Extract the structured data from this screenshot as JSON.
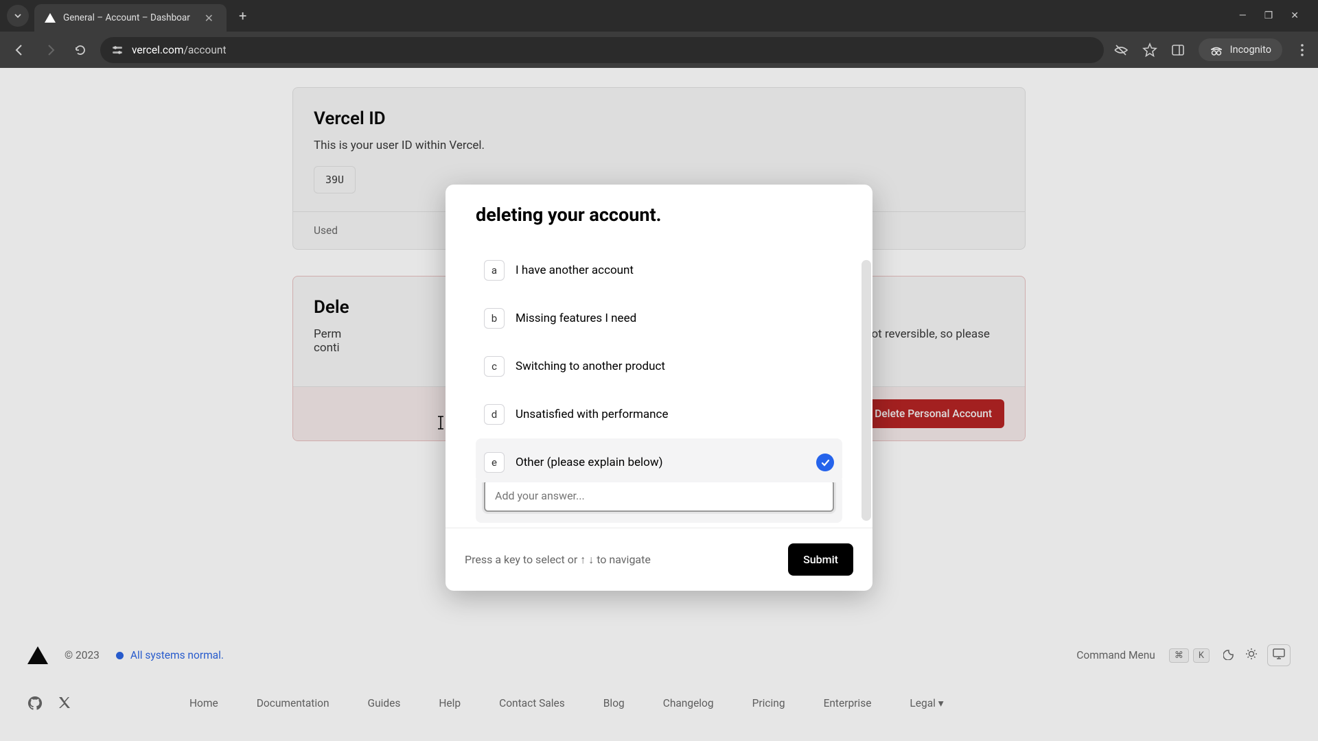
{
  "browser": {
    "tab_title": "General – Account – Dashboar",
    "url_prefix": "vercel.com",
    "url_path": "/account",
    "incognito_label": "Incognito"
  },
  "vercel_id_card": {
    "title": "Vercel ID",
    "desc": "This is your user ID within Vercel.",
    "value": "39U",
    "footer": "Used"
  },
  "delete_card": {
    "title_prefix": "Dele",
    "desc_line1a": "Perm",
    "desc_line1b": "atform. This action is not reversible, so please",
    "desc_line2": "conti",
    "button": "Delete Personal Account"
  },
  "modal": {
    "title": "deleting your account.",
    "options": [
      {
        "key": "a",
        "label": "I have another account",
        "selected": false
      },
      {
        "key": "b",
        "label": "Missing features I need",
        "selected": false
      },
      {
        "key": "c",
        "label": "Switching to another product",
        "selected": false
      },
      {
        "key": "d",
        "label": "Unsatisfied with performance",
        "selected": false
      },
      {
        "key": "e",
        "label": "Other (please explain below)",
        "selected": true
      }
    ],
    "input_placeholder": "Add your answer...",
    "footer_hint": "Press a key to select or ↑ ↓ to navigate",
    "submit": "Submit"
  },
  "footer": {
    "copyright": "© 2023",
    "status": "All systems normal.",
    "command_menu": "Command Menu",
    "cmd_key1": "⌘",
    "cmd_key2": "K",
    "links": [
      "Home",
      "Documentation",
      "Guides",
      "Help",
      "Contact Sales",
      "Blog",
      "Changelog",
      "Pricing",
      "Enterprise",
      "Legal ▾"
    ]
  }
}
